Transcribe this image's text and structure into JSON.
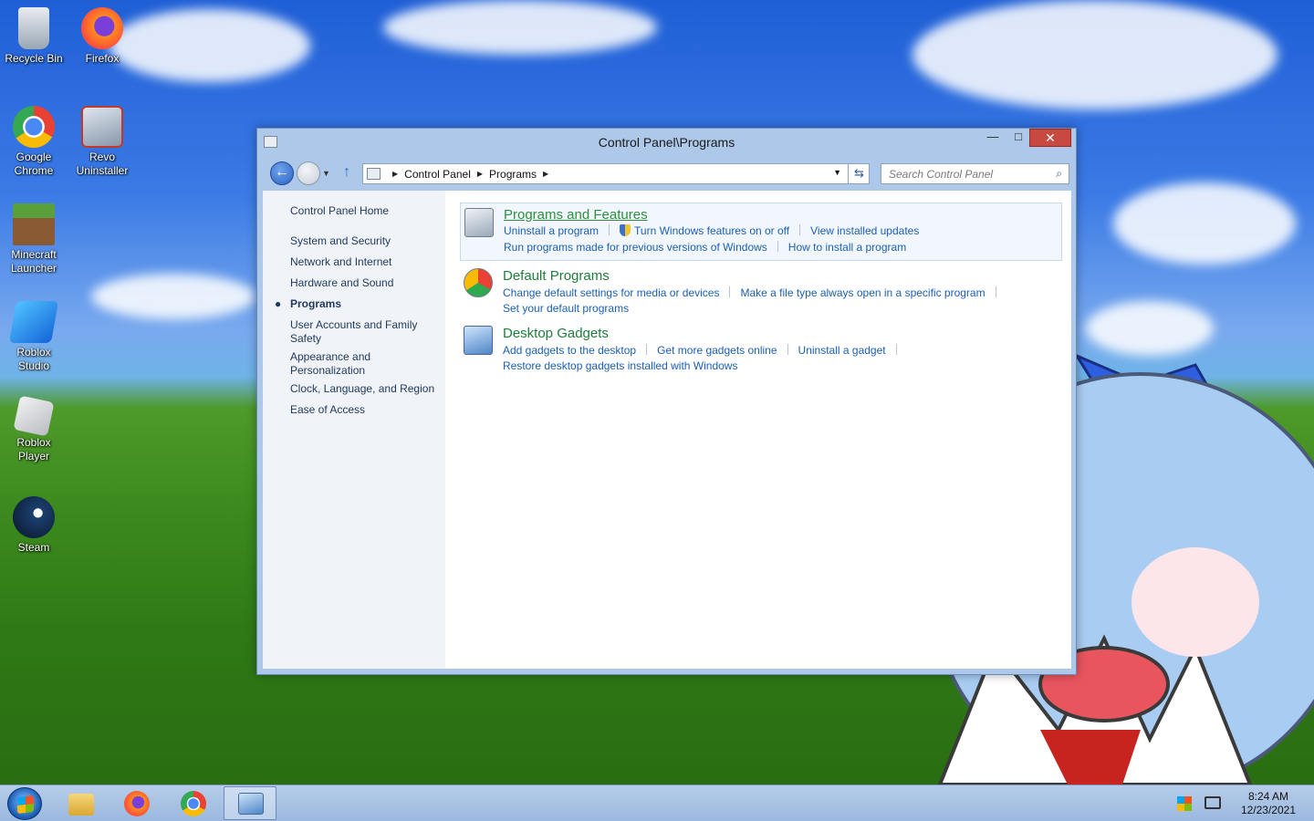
{
  "desktop": {
    "icons": [
      {
        "label": "Recycle Bin",
        "icon": "recycle-bin-icon"
      },
      {
        "label": "Firefox",
        "icon": "firefox-icon"
      },
      {
        "label": "Google Chrome",
        "icon": "chrome-icon"
      },
      {
        "label": "Revo Uninstaller",
        "icon": "revo-uninstaller-icon"
      },
      {
        "label": "Minecraft Launcher",
        "icon": "minecraft-icon"
      },
      {
        "label": "Roblox Studio",
        "icon": "roblox-studio-icon"
      },
      {
        "label": "Roblox Player",
        "icon": "roblox-player-icon"
      },
      {
        "label": "Steam",
        "icon": "steam-icon"
      }
    ]
  },
  "window": {
    "title": "Control Panel\\Programs",
    "controls": {
      "minimize": "—",
      "maximize": "□",
      "close": "✕"
    },
    "breadcrumb": [
      "Control Panel",
      "Programs"
    ],
    "search_placeholder": "Search Control Panel"
  },
  "sidebar": {
    "home": "Control Panel Home",
    "items": [
      "System and Security",
      "Network and Internet",
      "Hardware and Sound",
      "Programs",
      "User Accounts and Family Safety",
      "Appearance and Personalization",
      "Clock, Language, and Region",
      "Ease of Access"
    ],
    "active_index": 3
  },
  "categories": [
    {
      "title": "Programs and Features",
      "links_row1": [
        "Uninstall a program",
        "Turn Windows features on or off",
        "View installed updates"
      ],
      "links_row2": [
        "Run programs made for previous versions of Windows",
        "How to install a program"
      ]
    },
    {
      "title": "Default Programs",
      "links_row1": [
        "Change default settings for media or devices",
        "Make a file type always open in a specific program"
      ],
      "links_row2": [
        "Set your default programs"
      ]
    },
    {
      "title": "Desktop Gadgets",
      "links_row1": [
        "Add gadgets to the desktop",
        "Get more gadgets online",
        "Uninstall a gadget"
      ],
      "links_row2": [
        "Restore desktop gadgets installed with Windows"
      ]
    }
  ],
  "taskbar": {
    "time": "8:24 AM",
    "date": "12/23/2021",
    "pinned": [
      "file-explorer-icon",
      "firefox-icon",
      "chrome-icon",
      "control-panel-icon"
    ]
  }
}
